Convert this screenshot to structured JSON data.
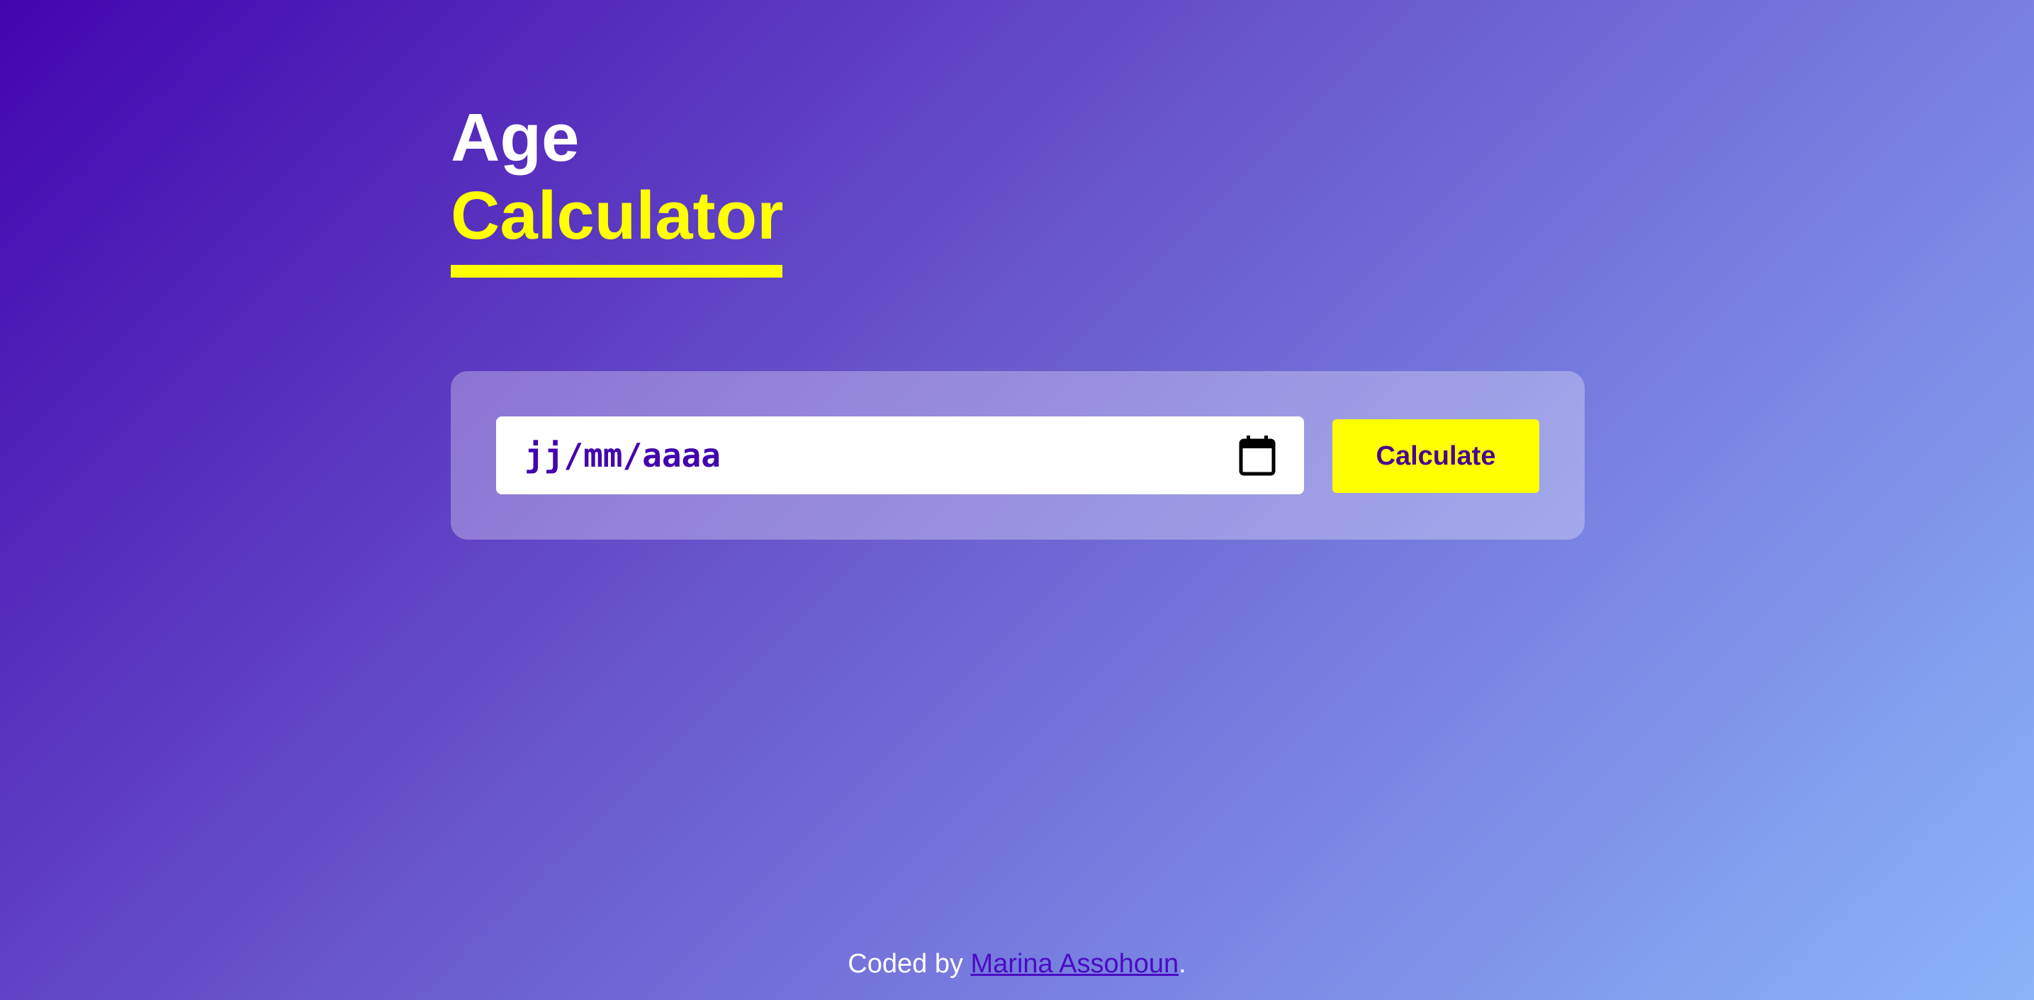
{
  "title": {
    "line1": "Age",
    "line2": "Calculator"
  },
  "form": {
    "date_placeholder": "jj/mm/aaaa",
    "calendar_icon": "calendar-icon",
    "submit_label": "Calculate"
  },
  "footer": {
    "prefix": "Coded by ",
    "author": "Marina Assohoun",
    "suffix": "."
  },
  "colors": {
    "accent": "#ffff00",
    "primary": "#4305ae",
    "background_start": "#4305ae",
    "background_end": "#8ab4f8"
  }
}
